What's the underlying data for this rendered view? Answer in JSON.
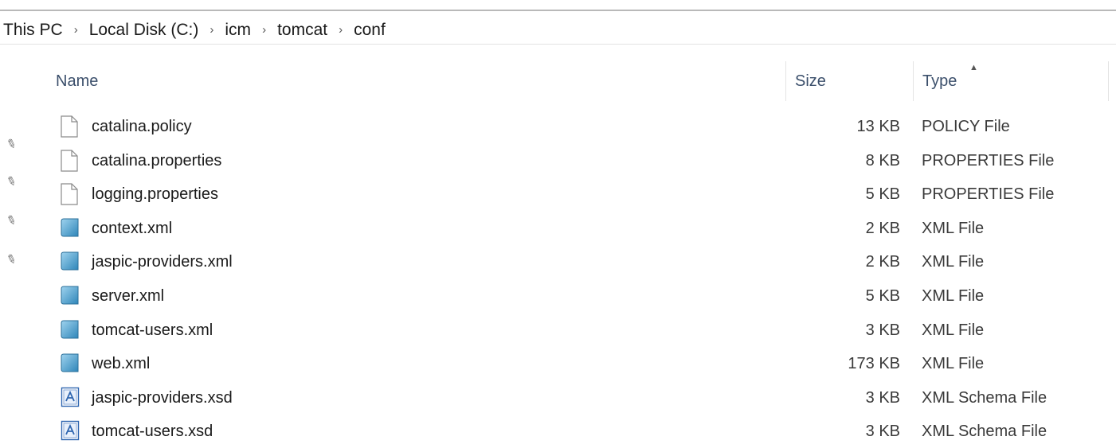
{
  "breadcrumb": [
    "This PC",
    "Local Disk (C:)",
    "icm",
    "tomcat",
    "conf"
  ],
  "breadcrumb_separator": "›",
  "columns": {
    "name": "Name",
    "size": "Size",
    "type": "Type"
  },
  "sort": {
    "column": "Type",
    "direction": "ascending"
  },
  "files": [
    {
      "name": "catalina.policy",
      "size": "13 KB",
      "type": "POLICY File",
      "icon": "generic-file-icon"
    },
    {
      "name": "catalina.properties",
      "size": "8 KB",
      "type": "PROPERTIES File",
      "icon": "generic-file-icon"
    },
    {
      "name": "logging.properties",
      "size": "5 KB",
      "type": "PROPERTIES File",
      "icon": "generic-file-icon"
    },
    {
      "name": "context.xml",
      "size": "2 KB",
      "type": "XML File",
      "icon": "xml-file-icon"
    },
    {
      "name": "jaspic-providers.xml",
      "size": "2 KB",
      "type": "XML File",
      "icon": "xml-file-icon"
    },
    {
      "name": "server.xml",
      "size": "5 KB",
      "type": "XML File",
      "icon": "xml-file-icon"
    },
    {
      "name": "tomcat-users.xml",
      "size": "3 KB",
      "type": "XML File",
      "icon": "xml-file-icon"
    },
    {
      "name": "web.xml",
      "size": "173 KB",
      "type": "XML File",
      "icon": "xml-file-icon"
    },
    {
      "name": "jaspic-providers.xsd",
      "size": "3 KB",
      "type": "XML Schema File",
      "icon": "xsd-file-icon"
    },
    {
      "name": "tomcat-users.xsd",
      "size": "3 KB",
      "type": "XML Schema File",
      "icon": "xsd-file-icon"
    }
  ],
  "colors": {
    "header_text": "#3b4f6b",
    "xml_icon": "#4a9cc7",
    "xsd_icon": "#2f66b0"
  }
}
